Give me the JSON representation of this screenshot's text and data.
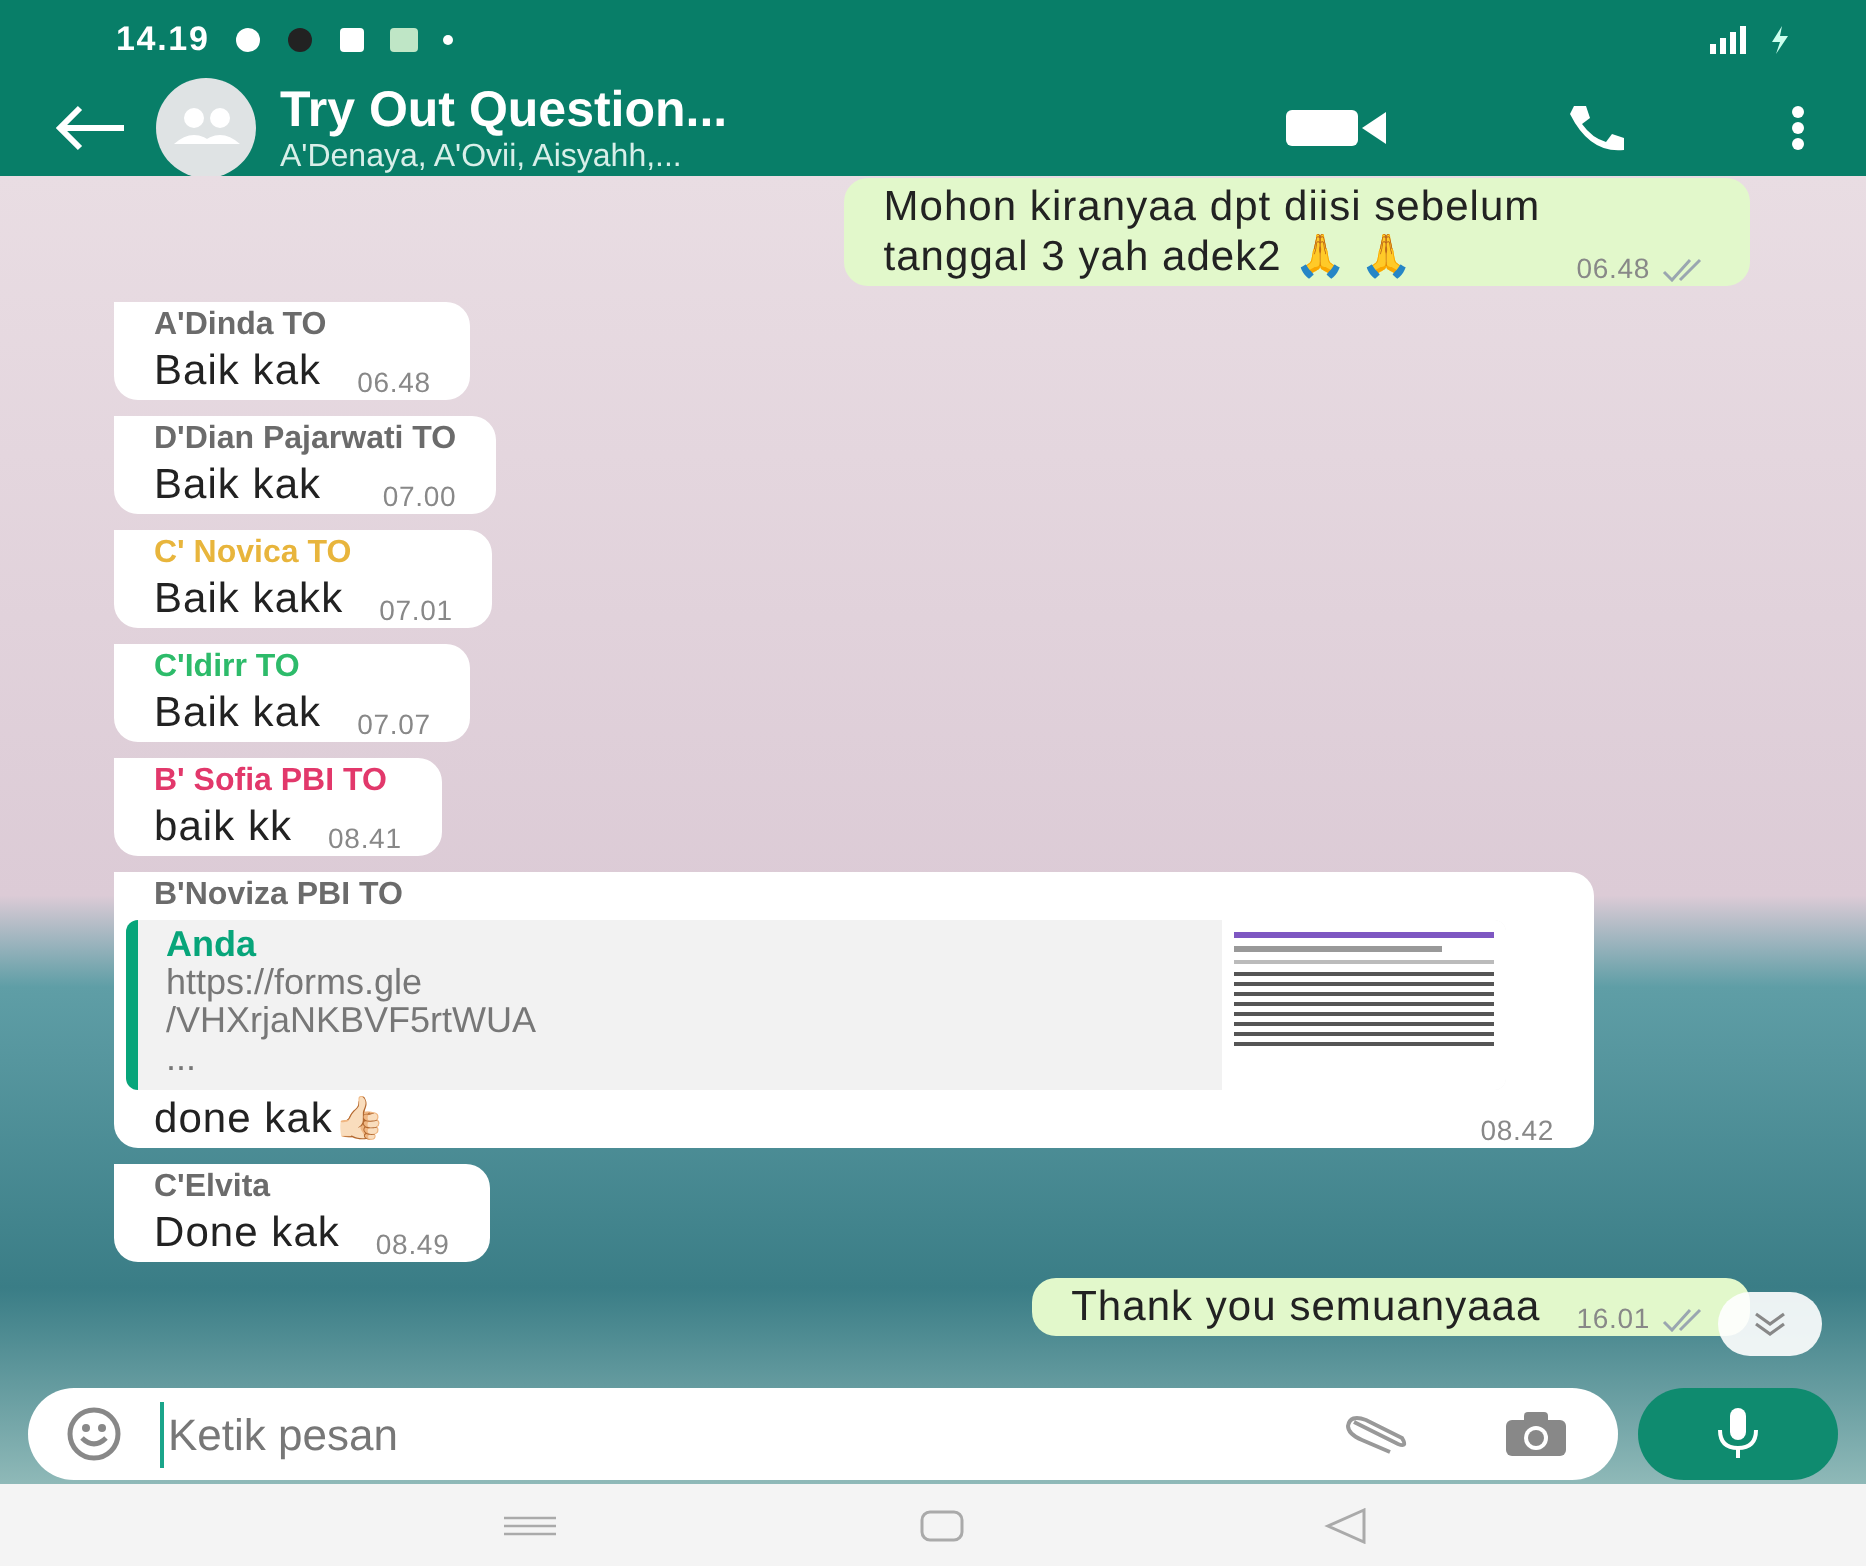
{
  "status_bar": {
    "time": "14.19"
  },
  "header": {
    "title": "Try Out Question...",
    "subtitle": "A'Denaya, A'Ovii, Aisyahh,..."
  },
  "messages": [
    {
      "kind": "outgoing",
      "lines": [
        "Mohon kiranyaa dpt diisi sebelum",
        "tanggal 3 yah adek2 🙏 🙏"
      ],
      "time": "06.48",
      "read": true
    },
    {
      "kind": "incoming",
      "sender": "A'Dinda TO",
      "color": "#6b6b6b",
      "lines": [
        "Baik kak"
      ],
      "time": "06.48"
    },
    {
      "kind": "incoming",
      "sender": "D'Dian Pajarwati TO",
      "color": "#6b6b6b",
      "lines": [
        "Baik kak"
      ],
      "time": "07.00"
    },
    {
      "kind": "incoming",
      "sender": "C' Novica TO",
      "color": "#e8b53c",
      "lines": [
        "Baik kakk"
      ],
      "time": "07.01"
    },
    {
      "kind": "incoming",
      "sender": "C'Idirr TO",
      "color": "#2dbb6a",
      "lines": [
        "Baik kak"
      ],
      "time": "07.07"
    },
    {
      "kind": "incoming",
      "sender": "B' Sofia PBI TO",
      "color": "#e2386b",
      "lines": [
        "baik kk"
      ],
      "time": "08.41"
    },
    {
      "kind": "incoming",
      "sender": "B'Noviza PBI TO",
      "color": "#6b6b6b",
      "quote": {
        "author": "Anda",
        "lines": [
          "https://forms.gle",
          "/VHXrjaNKBVF5rtWUA",
          "..."
        ]
      },
      "lines": [
        "done kak👍🏻"
      ],
      "time": "08.42"
    },
    {
      "kind": "incoming",
      "sender": "C'Elvita",
      "color": "#6b6b6b",
      "lines": [
        "Done kak"
      ],
      "time": "08.49"
    },
    {
      "kind": "outgoing",
      "lines": [
        "Thank you semuanyaaa"
      ],
      "time": "16.01",
      "read": true
    }
  ],
  "composer": {
    "placeholder": "Ketik pesan"
  }
}
